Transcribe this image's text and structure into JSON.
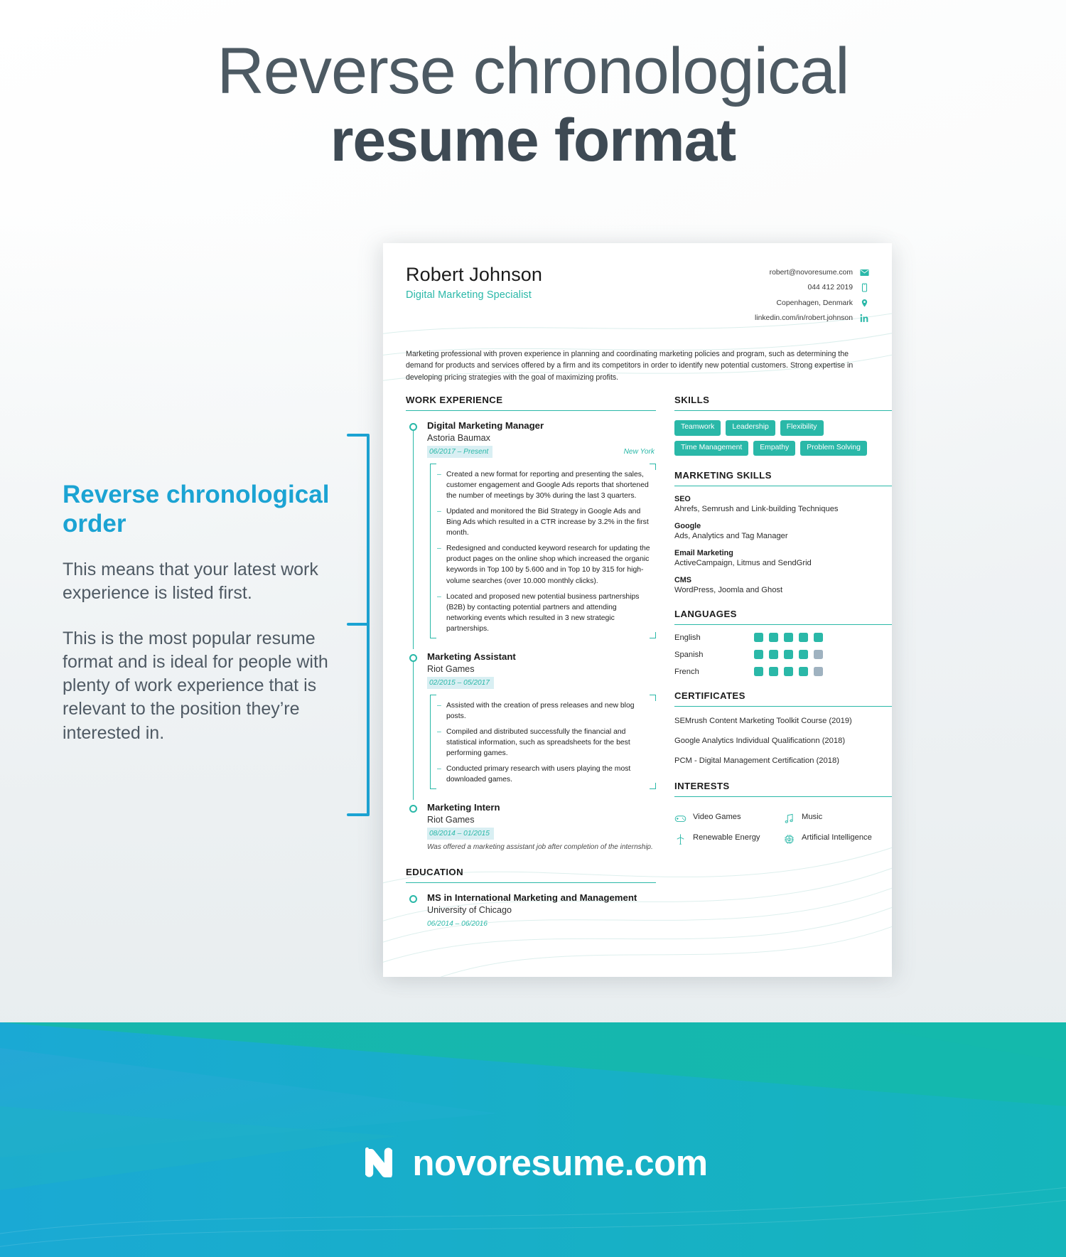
{
  "headline": {
    "line1": "Reverse chronological",
    "line2": "resume format"
  },
  "annotation": {
    "heading": "Reverse chronological order",
    "paragraph1": "This means that your latest work experience is listed first.",
    "paragraph2": "This is the most popular resume format and is ideal for people with plenty of work experience that is relevant to the position they’re interested in."
  },
  "resume": {
    "name": "Robert Johnson",
    "title": "Digital Marketing Specialist",
    "contact": [
      {
        "text": "robert@novoresume.com",
        "icon": "email-icon"
      },
      {
        "text": "044 412 2019",
        "icon": "phone-icon"
      },
      {
        "text": "Copenhagen, Denmark",
        "icon": "location-pin-icon"
      },
      {
        "text": "linkedin.com/in/robert.johnson",
        "icon": "linkedin-icon"
      }
    ],
    "summary": "Marketing professional with proven experience in planning and coordinating marketing policies and program, such as determining the demand for products and services offered by a firm and its competitors in order to identify new potential customers. Strong expertise in developing pricing strategies with the goal of maximizing profits.",
    "work_experience": {
      "section_title": "WORK EXPERIENCE",
      "entries": [
        {
          "role": "Digital Marketing Manager",
          "org": "Astoria Baumax",
          "date": "06/2017 – Present",
          "place": "New York",
          "bullets": [
            "Created a new format for reporting and presenting the sales, customer engagement and Google Ads reports that shortened the number of meetings by 30% during the last 3 quarters.",
            "Updated and monitored the Bid Strategy in Google Ads and Bing Ads which resulted in a CTR increase by 3.2% in the first month.",
            "Redesigned and conducted keyword research for updating the product pages on the online shop which increased the organic keywords in Top 100 by 5.600 and in Top 10 by 315 for high-volume searches (over 10.000 monthly clicks).",
            "Located and proposed new potential business partnerships (B2B) by contacting potential partners and attending networking events which resulted in 3 new strategic partnerships."
          ],
          "note": ""
        },
        {
          "role": "Marketing Assistant",
          "org": "Riot Games",
          "date": "02/2015 – 05/2017",
          "place": "",
          "bullets": [
            "Assisted with the creation of press releases and new blog posts.",
            "Compiled and distributed successfully the financial and statistical information, such as spreadsheets for the best performing games.",
            "Conducted primary research with users playing the most downloaded games."
          ],
          "note": ""
        },
        {
          "role": "Marketing Intern",
          "org": "Riot Games",
          "date": "08/2014 – 01/2015",
          "place": "",
          "bullets": [],
          "note": "Was offered a marketing assistant job after completion of the internship."
        }
      ]
    },
    "education": {
      "section_title": "EDUCATION",
      "entries": [
        {
          "degree": "MS in International Marketing and Management",
          "school": "University of Chicago",
          "date": "06/2014 – 06/2016"
        }
      ]
    },
    "skills": {
      "section_title": "SKILLS",
      "items": [
        "Teamwork",
        "Leadership",
        "Flexibility",
        "Time Management",
        "Empathy",
        "Problem Solving"
      ]
    },
    "marketing_skills": {
      "section_title": "MARKETING SKILLS",
      "items": [
        {
          "key": "SEO",
          "value": "Ahrefs, Semrush and Link-building Techniques"
        },
        {
          "key": "Google",
          "value": "Ads, Analytics and Tag Manager"
        },
        {
          "key": "Email Marketing",
          "value": "ActiveCampaign, Litmus and SendGrid"
        },
        {
          "key": "CMS",
          "value": "WordPress, Joomla and Ghost"
        }
      ]
    },
    "languages": {
      "section_title": "LANGUAGES",
      "items": [
        {
          "name": "English",
          "level": 5,
          "max": 5
        },
        {
          "name": "Spanish",
          "level": 4,
          "max": 5
        },
        {
          "name": "French",
          "level": 4,
          "max": 5
        }
      ]
    },
    "certificates": {
      "section_title": "CERTIFICATES",
      "items": [
        "SEMrush Content Marketing Toolkit Course (2019)",
        "Google Analytics Individual Qualificationn (2018)",
        "PCM - Digital Management Certification (2018)"
      ]
    },
    "interests": {
      "section_title": "INTERESTS",
      "items": [
        {
          "label": "Video Games",
          "icon": "gamepad-icon"
        },
        {
          "label": "Music",
          "icon": "music-note-icon"
        },
        {
          "label": "Renewable Energy",
          "icon": "wind-turbine-icon"
        },
        {
          "label": "Artificial Intelligence",
          "icon": "cpu-chip-icon"
        }
      ]
    }
  },
  "footer": {
    "brand": "novoresume.com",
    "logo_icon": "novoresume-n-logo"
  },
  "colors": {
    "teal": "#2ab8a8",
    "blue_accent": "#1ba3d3",
    "headline_gray": "#4d5a63",
    "date_highlight": "#d9eff3",
    "lang_empty": "#9fb2c0",
    "footer_teal": "#17b3b0",
    "footer_blue": "#1aa8cc"
  }
}
